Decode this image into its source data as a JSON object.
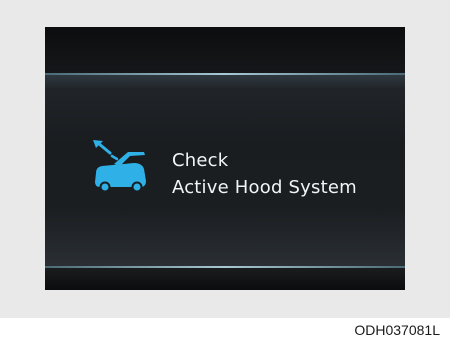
{
  "message": {
    "line1": "Check",
    "line2": "Active Hood System"
  },
  "figure_code": "ODH037081L",
  "icons": {
    "warning": "active-hood-warning-icon"
  },
  "colors": {
    "icon": "#2fb0e6",
    "text": "#f2f4f5",
    "display_background": "#0e0f10",
    "frame_background": "#e9e9e9"
  }
}
